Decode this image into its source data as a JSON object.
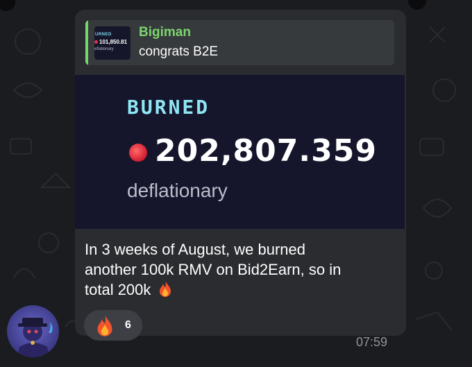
{
  "reply": {
    "sender": "Bigiman",
    "text": "congrats B2E"
  },
  "reply_thumb": {
    "burned": "URNED",
    "amount": "101,850.81",
    "sub": "eflationary"
  },
  "image": {
    "burned": "BURNED",
    "amount": "202,807.359",
    "sub": "deflationary"
  },
  "message": {
    "line1": "In 3 weeks of August, we burned",
    "line2": "another 100k RMV on Bid2Earn, so in",
    "line3": "total 200k"
  },
  "reaction": {
    "emoji": "fire-icon",
    "count": "6"
  },
  "time": "07:59",
  "colors": {
    "accent_green": "#6fd86b",
    "bubble": "#2b2c30",
    "background": "#1b1c1f"
  }
}
